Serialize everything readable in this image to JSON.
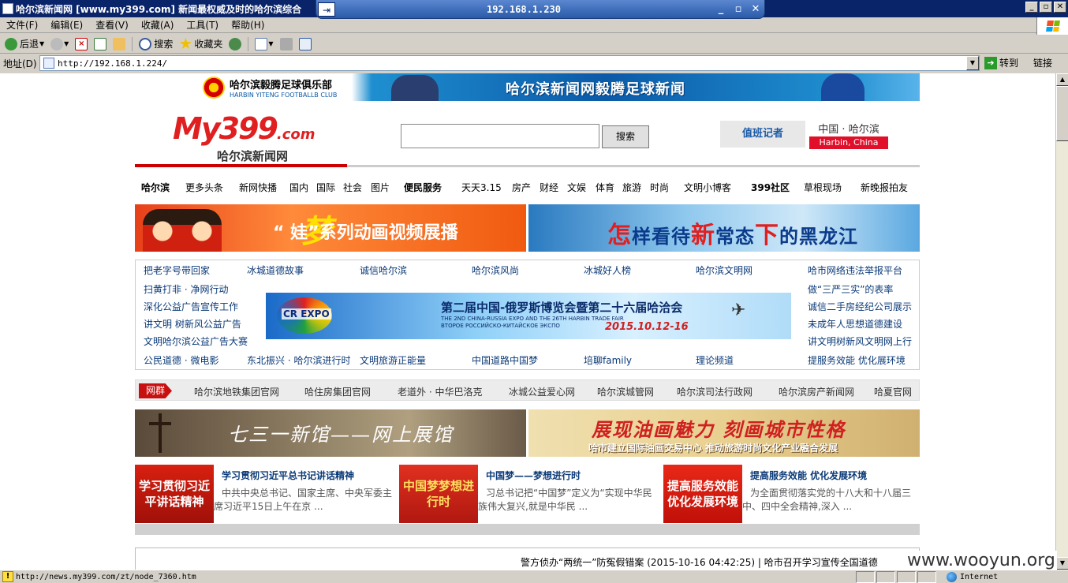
{
  "window": {
    "title": "哈尔滨新闻网 [www.my399.com] 新闻最权威及时的哈尔滨综合",
    "rdp_ip": "192.168.1.230"
  },
  "menu": [
    "文件(F)",
    "编辑(E)",
    "查看(V)",
    "收藏(A)",
    "工具(T)",
    "帮助(H)"
  ],
  "toolbar": {
    "back": "后退",
    "search": "搜索",
    "favorites": "收藏夹"
  },
  "address": {
    "label": "地址(D)",
    "url": "http://192.168.1.224/",
    "go": "转到",
    "links": "链接"
  },
  "page": {
    "top_banner": {
      "club_cn": "哈尔滨毅腾足球俱乐部",
      "club_en": "HARBIN YITENG FOOTBALLB CLUB",
      "title": "哈尔滨新闻网毅腾足球新闻"
    },
    "logo": {
      "main": "My399",
      "domain": ".com",
      "sub": "哈尔滨新闻网"
    },
    "search": {
      "placeholder": "",
      "button": "搜索"
    },
    "duty": "值班记者",
    "region": {
      "cn": "中国 · 哈尔滨",
      "en": "Harbin, China"
    },
    "nav": [
      "哈尔滨",
      "更多头条",
      "新网快播",
      "国内",
      "国际",
      "社会",
      "图片",
      "便民服务",
      "天天3.15",
      "房产",
      "财经",
      "文娱",
      "体育",
      "旅游",
      "时尚",
      "文明小博客",
      "399社区",
      "草根现场",
      "新晚报拍友"
    ],
    "hero_left": {
      "meng": "梦",
      "text": "“ 娃”系列动画视频展播"
    },
    "hero_right": {
      "a": "怎",
      "b": "样看待",
      "c": "新",
      "d": "常态",
      "e": "下",
      "f": "的黑龙江"
    },
    "links": {
      "row1": [
        "把老字号带回家",
        "冰城道德故事",
        "诚信哈尔滨",
        "哈尔滨风尚",
        "冰城好人榜",
        "哈尔滨文明网",
        "哈市网络违法举报平台"
      ],
      "left": [
        "扫黄打非 · 净网行动",
        "深化公益广告宣传工作",
        "讲文明 树新风公益广告",
        "文明哈尔滨公益广告大赛"
      ],
      "right": [
        "做“三严三实”的表率",
        "诚信二手房经纪公司展示",
        "未成年人思想道德建设",
        "讲文明树新风文明网上行"
      ],
      "row_last": [
        "公民道德 · 微电影",
        "东北振兴 · 哈尔滨进行时",
        "文明旅游正能量",
        "中国道路中国梦",
        "培聊family",
        "理论频道",
        "提服务效能 优化展环境"
      ]
    },
    "expo": {
      "logo": "CR EXPO",
      "title": "第二届中国-俄罗斯博览会暨第二十六届哈洽会",
      "en": "THE 2ND CHINA-RUSSIA EXPO AND THE 26TH HARBIN TRADE FAIR",
      "ru": "ВТОРОЕ РОССИЙСКО-КИТАЙСКОЕ ЭКСПО",
      "date": "2015.10.12-16"
    },
    "netlinks": {
      "tag": "网群",
      "items": [
        "哈尔滨地铁集团官网",
        "哈住房集团官网",
        "老道外 · 中华巴洛克",
        "冰城公益爱心网",
        "哈尔滨城管网",
        "哈尔滨司法行政网",
        "哈尔滨房产新闻网",
        "哈夏官网"
      ]
    },
    "feature_left": "七三一新馆——网上展馆",
    "feature_right": {
      "title": "展现油画魅力 刻画城市性格",
      "sub": "哈市建立国际油画交易中心 推动旅游时尚文化产业融合发展"
    },
    "articles": [
      {
        "img": "学习贯彻习近平讲话精神",
        "title": "学习贯彻习近平总书记讲话精神",
        "body": "中共中央总书记、国家主席、中央军委主席习近平15日上午在京 ..."
      },
      {
        "img": "中国梦梦想进行时",
        "title": "中国梦——梦想进行时",
        "body": "习总书记把“中国梦”定义为“实现中华民族伟大复兴,就是中华民 ..."
      },
      {
        "img": "提高服务效能优化发展环境",
        "title": "提高服务效能 优化发展环境",
        "body": "为全面贯彻落实党的十八大和十八届三中、四中全会精神,深入 ..."
      }
    ],
    "ticker": "警方侦办“两统一”防冤假错案 (2015-10-16 04:42:25) | 哈市召开学习宣传全国道德"
  },
  "status": {
    "url": "http://news.my399.com/zt/node_7360.htm",
    "zone": "Internet"
  },
  "watermark": "www.wooyun.org"
}
